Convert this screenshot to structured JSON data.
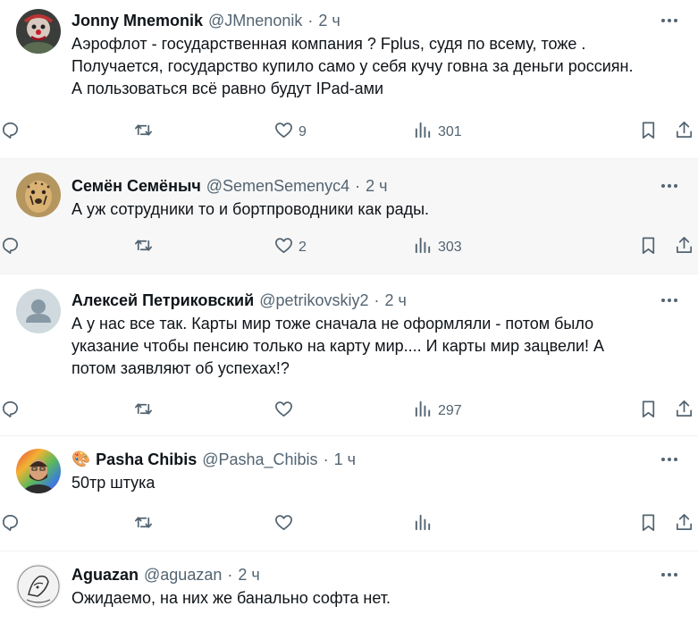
{
  "tweets": [
    {
      "name": "Jonny Mnemonik",
      "handle": "@JMnenonik",
      "sep": "·",
      "time": "2 ч",
      "text": "Аэрофлот - государственная компания ? Fplus, судя по всему, тоже .\nПолучается, государство купило само у себя кучу говна за деньги россиян.\nА пользоваться всё равно будут IPad-ами",
      "likes": "9",
      "views": "301"
    },
    {
      "name": "Семён Семёныч",
      "handle": "@SemenSemenyc4",
      "sep": "·",
      "time": "2 ч",
      "text": "А уж сотрудники то и бортпроводники как рады.",
      "likes": "2",
      "views": "303"
    },
    {
      "name": "Алексей Петриковский",
      "handle": "@petrikovskiy2",
      "sep": "·",
      "time": "2 ч",
      "text": "А у нас все так. Карты мир тоже сначала не оформляли - потом было\nуказание чтобы пенсию только на карту мир.... И карты мир зацвели! А\nпотом заявляют об успехах!?",
      "likes": "",
      "views": "297"
    },
    {
      "emoji": "🎨",
      "name": "Pasha Chibis",
      "handle": "@Pasha_Chibis",
      "sep": "·",
      "time": "1 ч",
      "text": "50тр штука",
      "likes": "",
      "views": ""
    },
    {
      "name": "Aguazan",
      "handle": "@aguazan",
      "sep": "·",
      "time": "2 ч",
      "text": "Ожидаемо, на них же банально софта нет."
    }
  ],
  "icons": {
    "reply": "reply-icon",
    "retweet": "retweet-icon",
    "like": "heart-icon",
    "views": "views-icon",
    "bookmark": "bookmark-icon",
    "share": "share-icon",
    "more": "more-icon"
  },
  "colors": {
    "text": "#0f1419",
    "secondary": "#536471",
    "highlight_bg": "#f7f7f7",
    "divider": "#eff3f4"
  }
}
